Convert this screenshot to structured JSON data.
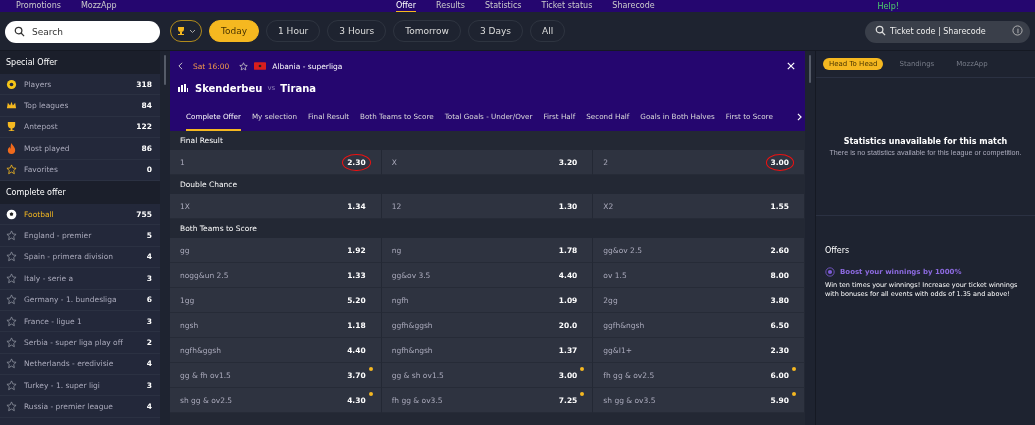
{
  "top_nav": {
    "left": [
      "Promotions",
      "MozzApp"
    ],
    "center": [
      {
        "label": "Offer",
        "selected": true
      },
      {
        "label": "Results",
        "selected": false
      },
      {
        "label": "Statistics",
        "selected": false
      },
      {
        "label": "Ticket status",
        "selected": false
      },
      {
        "label": "Sharecode",
        "selected": false
      }
    ],
    "help": "Help!"
  },
  "search": {
    "placeholder": "Search"
  },
  "time_filters": [
    {
      "label": "Today",
      "selected": true
    },
    {
      "label": "1 Hour",
      "selected": false
    },
    {
      "label": "3 Hours",
      "selected": false
    },
    {
      "label": "Tomorrow",
      "selected": false
    },
    {
      "label": "3 Days",
      "selected": false
    },
    {
      "label": "All",
      "selected": false
    }
  ],
  "ticket_search": {
    "placeholder": "Ticket code | Sharecode"
  },
  "sidebar": {
    "sections": [
      {
        "title": "Special Offer",
        "items": [
          {
            "kind": "players",
            "label": "Players",
            "count": "318",
            "selected": false
          },
          {
            "kind": "top",
            "label": "Top leagues",
            "count": "84",
            "selected": false
          },
          {
            "kind": "antepost",
            "label": "Antepost",
            "count": "122",
            "selected": false
          },
          {
            "kind": "hot",
            "label": "Most played",
            "count": "86",
            "selected": false
          },
          {
            "kind": "favorites",
            "label": "Favorites",
            "count": "0",
            "selected": false
          }
        ]
      },
      {
        "title": "Complete offer",
        "items": [
          {
            "kind": "sport",
            "label": "Football",
            "count": "755",
            "selected": true
          },
          {
            "kind": "league",
            "label": "England - premier",
            "count": "5",
            "selected": false
          },
          {
            "kind": "league",
            "label": "Spain - primera division",
            "count": "4",
            "selected": false
          },
          {
            "kind": "league",
            "label": "Italy - serie a",
            "count": "3",
            "selected": false
          },
          {
            "kind": "league",
            "label": "Germany - 1. bundesliga",
            "count": "6",
            "selected": false
          },
          {
            "kind": "league",
            "label": "France - ligue 1",
            "count": "3",
            "selected": false
          },
          {
            "kind": "league",
            "label": "Serbia - super liga play off",
            "count": "2",
            "selected": false
          },
          {
            "kind": "league",
            "label": "Netherlands - eredivisie",
            "count": "4",
            "selected": false
          },
          {
            "kind": "league",
            "label": "Turkey - 1. super ligi",
            "count": "3",
            "selected": false
          },
          {
            "kind": "league",
            "label": "Russia - premier league",
            "count": "4",
            "selected": false
          }
        ]
      }
    ]
  },
  "match": {
    "time": "Sat 16:00",
    "league": "Albania - superliga",
    "home": "Skenderbeu",
    "vs": "vs",
    "away": "Tirana",
    "tabs": [
      {
        "label": "Complete Offer",
        "selected": true
      },
      {
        "label": "My selection",
        "selected": false
      },
      {
        "label": "Final Result",
        "selected": false
      },
      {
        "label": "Both Teams to Score",
        "selected": false
      },
      {
        "label": "Total Goals - Under/Over",
        "selected": false
      },
      {
        "label": "First Half",
        "selected": false
      },
      {
        "label": "Second Half",
        "selected": false
      },
      {
        "label": "Goals in Both Halves",
        "selected": false
      },
      {
        "label": "First to Score",
        "selected": false
      }
    ],
    "markets": [
      {
        "title": "Final Result",
        "rows": [
          [
            {
              "name": "1",
              "odd": "2.30",
              "circled": true,
              "marked": false
            },
            {
              "name": "X",
              "odd": "3.20",
              "circled": false,
              "marked": false
            },
            {
              "name": "2",
              "odd": "3.00",
              "circled": true,
              "marked": false
            }
          ]
        ]
      },
      {
        "title": "Double Chance",
        "rows": [
          [
            {
              "name": "1X",
              "odd": "1.34",
              "circled": false,
              "marked": false
            },
            {
              "name": "12",
              "odd": "1.30",
              "circled": false,
              "marked": false
            },
            {
              "name": "X2",
              "odd": "1.55",
              "circled": false,
              "marked": false
            }
          ]
        ]
      },
      {
        "title": "Both Teams to Score",
        "rows": [
          [
            {
              "name": "gg",
              "odd": "1.92",
              "circled": false,
              "marked": false
            },
            {
              "name": "ng",
              "odd": "1.78",
              "circled": false,
              "marked": false
            },
            {
              "name": "gg&ov 2.5",
              "odd": "2.60",
              "circled": false,
              "marked": false
            }
          ],
          [
            {
              "name": "nogg&un 2.5",
              "odd": "1.33",
              "circled": false,
              "marked": false
            },
            {
              "name": "gg&ov 3.5",
              "odd": "4.40",
              "circled": false,
              "marked": false
            },
            {
              "name": "ov 1.5",
              "odd": "8.00",
              "circled": false,
              "marked": false
            }
          ],
          [
            {
              "name": "1gg",
              "odd": "5.20",
              "circled": false,
              "marked": false
            },
            {
              "name": "ngfh",
              "odd": "1.09",
              "circled": false,
              "marked": false
            },
            {
              "name": "2gg",
              "odd": "3.80",
              "circled": false,
              "marked": false
            }
          ],
          [
            {
              "name": "ngsh",
              "odd": "1.18",
              "circled": false,
              "marked": false
            },
            {
              "name": "ggfh&ggsh",
              "odd": "20.0",
              "circled": false,
              "marked": false
            },
            {
              "name": "ggfh&ngsh",
              "odd": "6.50",
              "circled": false,
              "marked": false
            }
          ],
          [
            {
              "name": "ngfh&ggsh",
              "odd": "4.40",
              "circled": false,
              "marked": false
            },
            {
              "name": "ngfh&ngsh",
              "odd": "1.37",
              "circled": false,
              "marked": false
            },
            {
              "name": "gg&I1+",
              "odd": "2.30",
              "circled": false,
              "marked": false
            }
          ],
          [
            {
              "name": "gg & fh ov1.5",
              "odd": "3.70",
              "circled": false,
              "marked": true
            },
            {
              "name": "gg & sh ov1.5",
              "odd": "3.00",
              "circled": false,
              "marked": true
            },
            {
              "name": "fh gg & ov2.5",
              "odd": "6.00",
              "circled": false,
              "marked": true
            }
          ],
          [
            {
              "name": "sh gg & ov2.5",
              "odd": "4.30",
              "circled": false,
              "marked": true
            },
            {
              "name": "fh gg & ov3.5",
              "odd": "7.25",
              "circled": false,
              "marked": true
            },
            {
              "name": "sh gg & ov3.5",
              "odd": "5.90",
              "circled": false,
              "marked": true
            }
          ]
        ]
      }
    ]
  },
  "stats": {
    "tabs": [
      {
        "label": "Head To Head",
        "selected": true
      },
      {
        "label": "Standings",
        "selected": false
      },
      {
        "label": "MozzApp",
        "selected": false
      }
    ],
    "title": "Statistics unavailable for this match",
    "message": "There is no statistics available for this league or competition."
  },
  "offers": {
    "title": "Offers",
    "items": [
      {
        "title": "Boost your winnings by 1000%",
        "text": "Win ten times your winnings! Increase your ticket winnings with bonuses for all events with odds of 1.35 and above!"
      }
    ]
  }
}
